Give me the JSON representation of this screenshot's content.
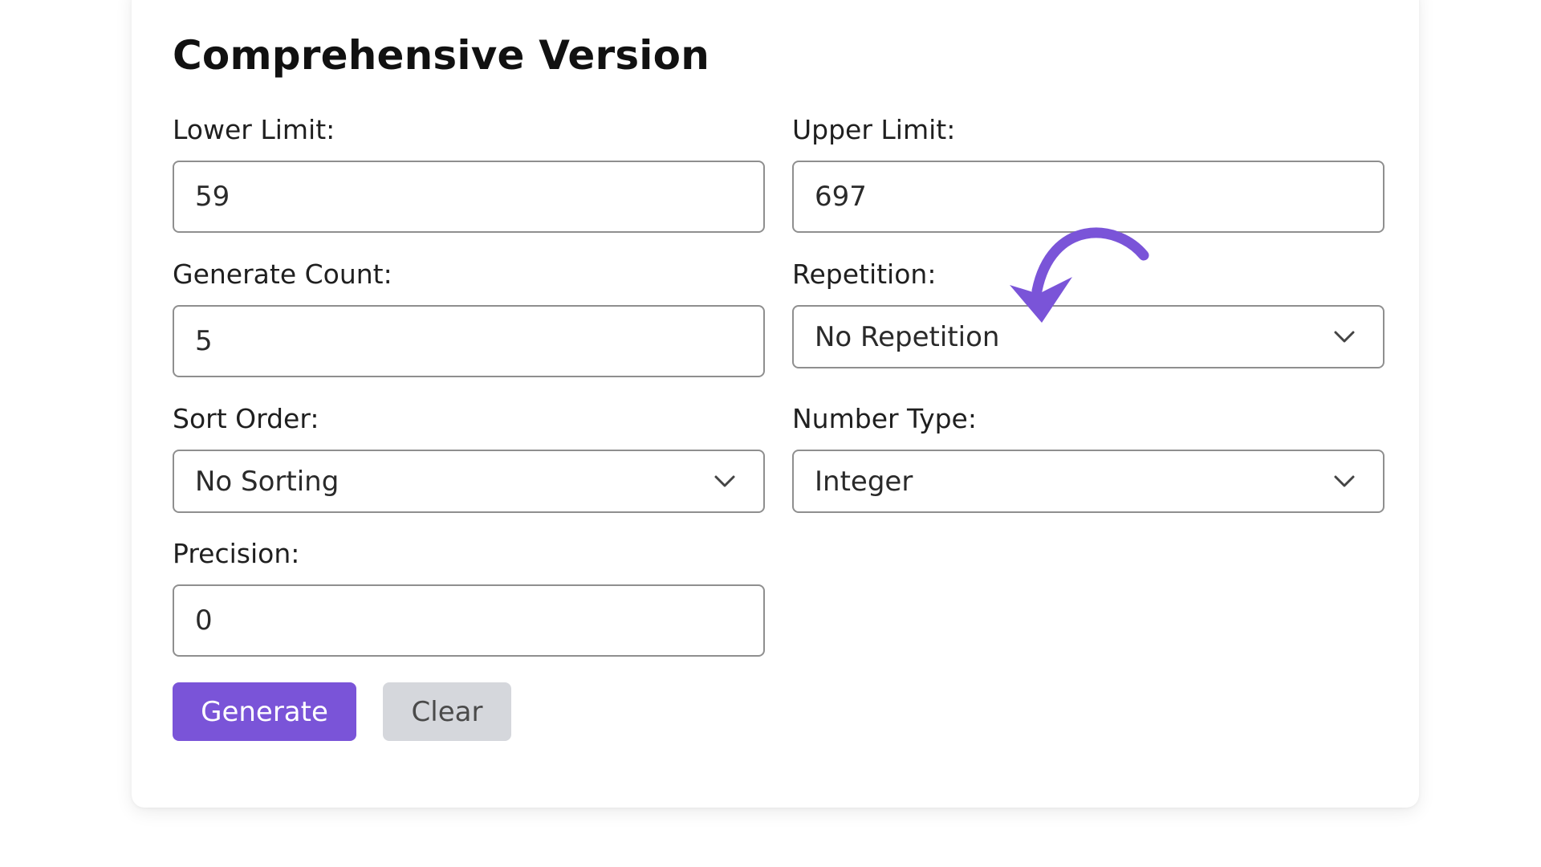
{
  "form": {
    "title": "Comprehensive Version",
    "lower_limit": {
      "label": "Lower Limit:",
      "value": "59"
    },
    "upper_limit": {
      "label": "Upper Limit:",
      "value": "697"
    },
    "generate_count": {
      "label": "Generate Count:",
      "value": "5"
    },
    "repetition": {
      "label": "Repetition:",
      "selected": "No Repetition"
    },
    "sort_order": {
      "label": "Sort Order:",
      "selected": "No Sorting"
    },
    "number_type": {
      "label": "Number Type:",
      "selected": "Integer"
    },
    "precision": {
      "label": "Precision:",
      "value": "0"
    },
    "buttons": {
      "generate": "Generate",
      "clear": "Clear"
    }
  },
  "icons": {
    "dropdown": "chevron-down-icon",
    "annotation": "curved-arrow-icon"
  },
  "colors": {
    "accent": "#7a54d8",
    "clear_button_bg": "#d5d7dc",
    "border": "#8f8f8f"
  }
}
